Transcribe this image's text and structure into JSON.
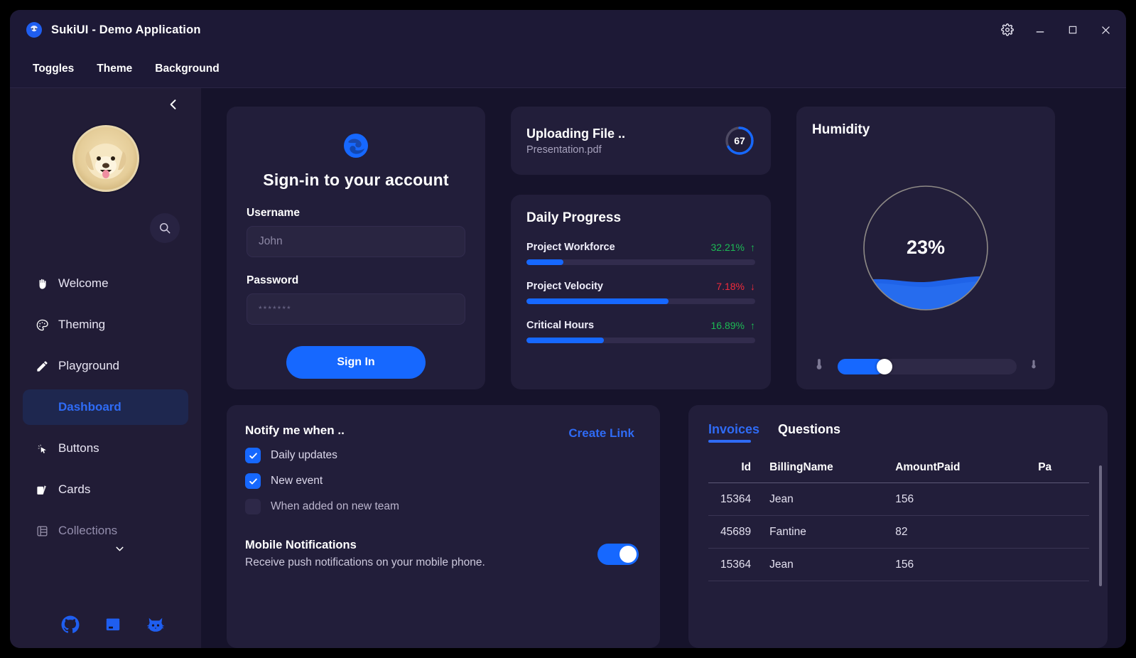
{
  "window": {
    "title": "SukiUI - Demo Application",
    "logo_icon": "suki-logo-icon",
    "controls": {
      "settings": "gear-icon",
      "minimize": "minimize-icon",
      "maximize": "maximize-icon",
      "close": "close-icon"
    }
  },
  "menubar": {
    "items": [
      {
        "label": "Toggles"
      },
      {
        "label": "Theme"
      },
      {
        "label": "Background"
      }
    ]
  },
  "sidebar": {
    "collapse_icon": "chevron-left-icon",
    "avatar": "dog-avatar",
    "search_icon": "search-icon",
    "items": [
      {
        "label": "Welcome",
        "icon": "hand-wave-icon",
        "selected": false,
        "dimmed": false
      },
      {
        "label": "Theming",
        "icon": "palette-icon",
        "selected": false,
        "dimmed": false
      },
      {
        "label": "Playground",
        "icon": "pencil-icon",
        "selected": false,
        "dimmed": false
      },
      {
        "label": "Dashboard",
        "icon": "dashboard-icon",
        "selected": true,
        "dimmed": false
      },
      {
        "label": "Buttons",
        "icon": "cursor-click-icon",
        "selected": false,
        "dimmed": false
      },
      {
        "label": "Cards",
        "icon": "cards-icon",
        "selected": false,
        "dimmed": false
      },
      {
        "label": "Collections",
        "icon": "table-list-icon",
        "selected": false,
        "dimmed": true
      }
    ],
    "socials": [
      {
        "name": "github-icon"
      },
      {
        "name": "nuget-package-icon"
      },
      {
        "name": "cat-icon"
      }
    ]
  },
  "signin": {
    "logo_icon": "edge-browser-icon",
    "title": "Sign-in to your account",
    "username_label": "Username",
    "username_placeholder": "John",
    "password_label": "Password",
    "password_value": "*******",
    "button_label": "Sign In"
  },
  "upload": {
    "title": "Uploading File ..",
    "filename": "Presentation.pdf",
    "progress": 67,
    "progress_label": "67"
  },
  "daily_progress": {
    "title": "Daily Progress",
    "metrics": [
      {
        "name": "Project Workforce",
        "value": "32.21%",
        "direction": "up",
        "arrow": "↑",
        "fill": 16
      },
      {
        "name": "Project Velocity",
        "value": "7.18%",
        "direction": "down",
        "arrow": "↓",
        "fill": 62
      },
      {
        "name": "Critical Hours",
        "value": "16.89%",
        "direction": "up",
        "arrow": "↑",
        "fill": 34
      }
    ]
  },
  "humidity": {
    "title": "Humidity",
    "value_label": "23%",
    "value": 23,
    "slider_value": 26,
    "left_icon": "thermometer-icon",
    "right_icon": "thermometer-icon"
  },
  "notify": {
    "title": "Notify me when ..",
    "create_link_label": "Create Link",
    "options": [
      {
        "label": "Daily updates",
        "checked": true
      },
      {
        "label": "New event",
        "checked": true
      },
      {
        "label": "When added on new team",
        "checked": false
      }
    ],
    "mobile_title": "Mobile Notifications",
    "mobile_subtitle": "Receive push notifications on your mobile phone.",
    "mobile_enabled": true
  },
  "invoices": {
    "tabs": [
      {
        "label": "Invoices",
        "active": true
      },
      {
        "label": "Questions",
        "active": false
      }
    ],
    "columns": [
      "Id",
      "BillingName",
      "AmountPaid",
      "Pa"
    ],
    "rows": [
      {
        "id": "15364",
        "billing_name": "Jean",
        "amount_paid": "156",
        "pa": ""
      },
      {
        "id": "45689",
        "billing_name": "Fantine",
        "amount_paid": "82",
        "pa": ""
      },
      {
        "id": "15364",
        "billing_name": "Jean",
        "amount_paid": "156",
        "pa": ""
      }
    ]
  },
  "colors": {
    "accent": "#1668ff",
    "accent_text": "#2f6bf5",
    "background": "#16132b",
    "card": "#221e3a",
    "sidebar": "#211c36",
    "titlebar": "#1d1936",
    "up": "#1db954",
    "down": "#f02b3c"
  }
}
